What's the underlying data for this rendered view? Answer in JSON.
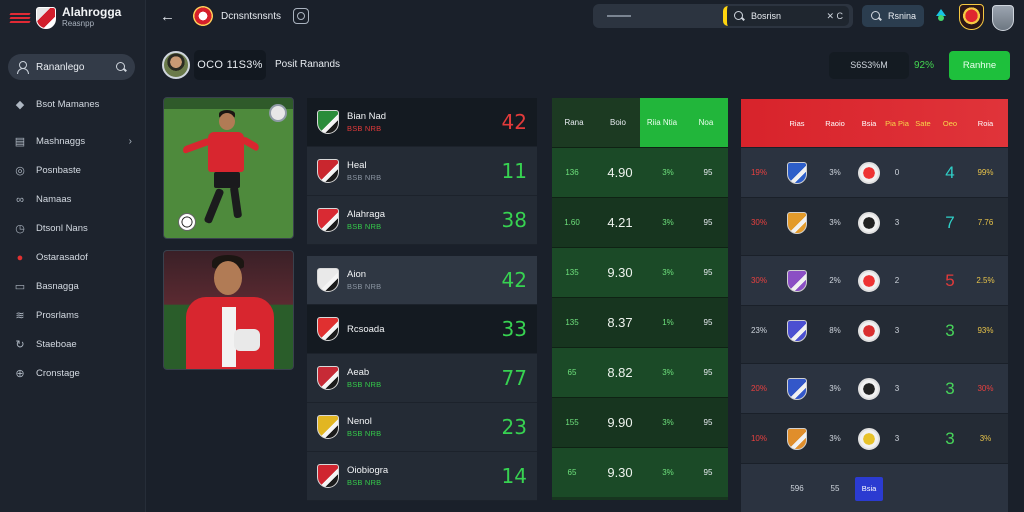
{
  "brand": {
    "title": "Alahrogga",
    "subtitle": "Reasnpp"
  },
  "sidebar": {
    "search_label": "Rananlego",
    "items": [
      {
        "label": "Bsot Mamanes",
        "icon": "tag-icon",
        "chevron": false
      },
      {
        "label": "Mashnaggs",
        "icon": "calendar-icon",
        "chevron": true
      },
      {
        "label": "Posnbaste",
        "icon": "ball-icon",
        "chevron": false
      },
      {
        "label": "Namaas",
        "icon": "link-icon",
        "chevron": false
      },
      {
        "label": "Dtsonl Nans",
        "icon": "clock-icon",
        "chevron": false
      },
      {
        "label": "Ostarasadof",
        "icon": "record-icon",
        "chevron": false
      },
      {
        "label": "Basnagga",
        "icon": "message-icon",
        "chevron": false
      },
      {
        "label": "Prosrlams",
        "icon": "news-icon",
        "chevron": false
      },
      {
        "label": "Staeboae",
        "icon": "refresh-icon",
        "chevron": false
      },
      {
        "label": "Cronstage",
        "icon": "globe-icon",
        "chevron": false
      }
    ]
  },
  "topbar": {
    "title": "Dcnsntsnsnts",
    "search_label": "Bosrisn",
    "search_clear": "✕ C",
    "button_label": "Rsnina"
  },
  "match": {
    "time": "OCO 11S3%",
    "title": "Posit Ranands",
    "stat_label": "S6S3%M",
    "stat_pct": "92%",
    "cta_label": "Ranhne"
  },
  "scores": {
    "panel1": [
      {
        "name": "Bian Nad",
        "sub": "BSB NRB",
        "score": "42",
        "style": "dark",
        "sub_color": "red",
        "score_color": "red",
        "crest": "#2a8c3a"
      },
      {
        "name": "Heal",
        "sub": "BSB NRB",
        "score": "11",
        "style": "",
        "sub_color": "gray",
        "score_color": "green",
        "crest": "#c9262e"
      },
      {
        "name": "Alahraga",
        "sub": "BSB NRB",
        "score": "38",
        "style": "",
        "sub_color": "green",
        "score_color": "green",
        "crest": "#d92a33"
      }
    ],
    "panel2": [
      {
        "name": "Aion",
        "sub": "BSB NRB",
        "score": "42",
        "style": "mid",
        "sub_color": "gray",
        "score_color": "green",
        "crest": "#e9e9e9"
      },
      {
        "name": "Rcsoada",
        "sub": "",
        "score": "33",
        "style": "dark",
        "sub_color": "gray",
        "score_color": "green",
        "crest": "#e03030"
      },
      {
        "name": "Aeab",
        "sub": "BSB NRB",
        "score": "77",
        "style": "",
        "sub_color": "green",
        "score_color": "green",
        "crest": "#c72a36"
      },
      {
        "name": "Nenol",
        "sub": "BSB NRB",
        "score": "23",
        "style": "",
        "sub_color": "green",
        "score_color": "green",
        "crest": "#e2b622"
      },
      {
        "name": "Oiobiogra",
        "sub": "BSB NRB",
        "score": "14",
        "style": "",
        "sub_color": "green",
        "score_color": "green",
        "crest": "#d02530"
      }
    ]
  },
  "odds": {
    "headers": [
      "Rana",
      "Boio",
      "Riia Ntia",
      "Noa"
    ],
    "rows": [
      [
        "136",
        "4.90",
        "3%",
        "95"
      ],
      [
        "1.60",
        "4.21",
        "3%",
        "95"
      ],
      [
        "135",
        "9.30",
        "3%",
        "95"
      ],
      [
        "135",
        "8.37",
        "1%",
        "95"
      ],
      [
        "65",
        "8.82",
        "3%",
        "95"
      ],
      [
        "155",
        "9.90",
        "3%",
        "95"
      ],
      [
        "65",
        "9.30",
        "3%",
        "95"
      ]
    ]
  },
  "standings": {
    "headers": [
      "Rias",
      "Raoio",
      "Bsia",
      "Pia Pia",
      "Sate",
      "Oeo",
      "Roia"
    ],
    "rows": [
      {
        "a": "19%",
        "a_color": "red",
        "shield": "#2d5ec9",
        "b": "3%",
        "badge": "#e33",
        "c": "0",
        "d": "4",
        "d_color": "c",
        "e": "99%",
        "e_color": "y"
      },
      {
        "a": "30%",
        "a_color": "red",
        "shield": "#e39b2b",
        "b": "3%",
        "badge": "#222",
        "c": "3",
        "d": "7",
        "d_color": "c",
        "e": "7.76",
        "e_color": "y"
      },
      {
        "a": "30%",
        "a_color": "red",
        "shield": "#8b4fc4",
        "b": "2%",
        "badge": "#e33",
        "c": "2",
        "d": "5",
        "d_color": "r",
        "e": "2.5%",
        "e_color": "y"
      },
      {
        "a": "23%",
        "a_color": "w",
        "shield": "#4b4fd1",
        "b": "8%",
        "badge": "#d92f2f",
        "c": "3",
        "d": "3",
        "d_color": "g",
        "e": "93%",
        "e_color": "y"
      },
      {
        "a": "20%",
        "a_color": "red",
        "shield": "#3357c9",
        "b": "3%",
        "badge": "#222",
        "c": "3",
        "d": "3",
        "d_color": "g",
        "e": "30%",
        "e_color": "red"
      },
      {
        "a": "10%",
        "a_color": "red",
        "shield": "#e08e2b",
        "b": "3%",
        "badge": "#e7c22a",
        "c": "3",
        "d": "3",
        "d_color": "g",
        "e": "3%",
        "e_color": "y"
      },
      {
        "a": "",
        "a_color": "w",
        "shield": "",
        "b": "",
        "badge": "",
        "c": "",
        "d": "",
        "d_color": "g",
        "e": "",
        "e_color": "y"
      }
    ],
    "last_row_tags": [
      "596",
      "55",
      "Bsia"
    ]
  }
}
